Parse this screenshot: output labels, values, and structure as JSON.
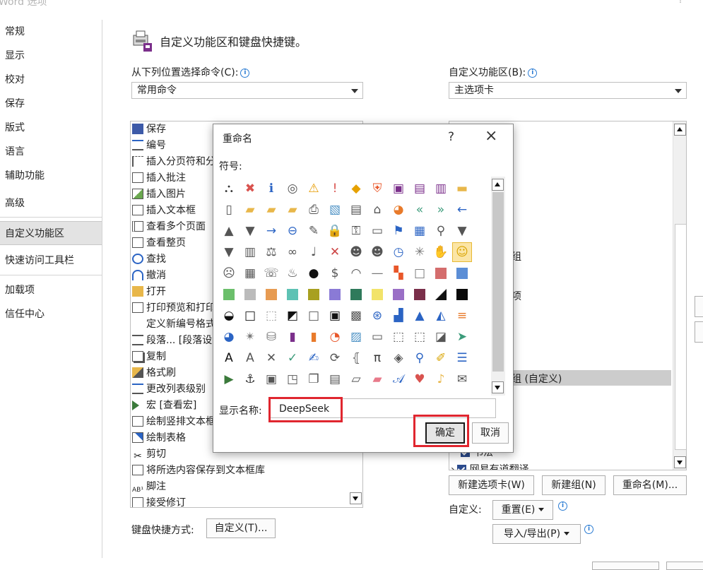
{
  "window": {
    "title": "Word 选项",
    "help": "?"
  },
  "nav": {
    "items": [
      {
        "label": "常规",
        "selected": false
      },
      {
        "label": "显示",
        "selected": false
      },
      {
        "label": "校对",
        "selected": false
      },
      {
        "label": "保存",
        "selected": false
      },
      {
        "label": "版式",
        "selected": false
      },
      {
        "label": "语言",
        "selected": false
      },
      {
        "label": "辅助功能",
        "selected": false
      },
      {
        "label": "高级",
        "selected": false
      },
      {
        "label": "自定义功能区",
        "selected": true
      },
      {
        "label": "快速访问工具栏",
        "selected": false
      },
      {
        "label": "加载项",
        "selected": false
      },
      {
        "label": "信任中心",
        "selected": false
      }
    ]
  },
  "header": {
    "title": "自定义功能区和键盘快捷键。"
  },
  "left_panel": {
    "choose_label": "从下列位置选择命令(C):",
    "choose_value": "常用命令",
    "commands": [
      {
        "label": "保存",
        "icon": "save-icon"
      },
      {
        "label": "编号",
        "icon": "numbering-icon"
      },
      {
        "label": "插入分页符和分",
        "icon": "page-break-icon"
      },
      {
        "label": "插入批注",
        "icon": "comment-icon"
      },
      {
        "label": "插入图片",
        "icon": "picture-icon"
      },
      {
        "label": "插入文本框",
        "icon": "textbox-icon"
      },
      {
        "label": "查看多个页面",
        "icon": "multi-page-icon"
      },
      {
        "label": "查看整页",
        "icon": "full-page-icon"
      },
      {
        "label": "查找",
        "icon": "find-icon"
      },
      {
        "label": "撤消",
        "icon": "undo-icon"
      },
      {
        "label": "打开",
        "icon": "open-icon"
      },
      {
        "label": "打印预览和打印",
        "icon": "print-preview-icon"
      },
      {
        "label": "定义新编号格式",
        "icon": ""
      },
      {
        "label": "段落... [段落设",
        "icon": "paragraph-icon"
      },
      {
        "label": "复制",
        "icon": "copy-icon"
      },
      {
        "label": "格式刷",
        "icon": "format-painter-icon"
      },
      {
        "label": "更改列表级别",
        "icon": "list-level-icon"
      },
      {
        "label": "宏 [查看宏]",
        "icon": "macro-icon"
      },
      {
        "label": "绘制竖排文本框",
        "icon": "vertical-textbox-icon"
      },
      {
        "label": "绘制表格",
        "icon": "draw-table-icon"
      },
      {
        "label": "剪切",
        "icon": "cut-icon"
      },
      {
        "label": "将所选内容保存到文本框库",
        "icon": "save-selection-icon"
      },
      {
        "label": "脚注",
        "icon": "footnote-icon"
      },
      {
        "label": "接受修订",
        "icon": "accept-icon"
      }
    ],
    "keyboard_label": "键盘快捷方式:",
    "keyboard_button": "自定义(T)..."
  },
  "right_panel": {
    "customize_label": "自定义功能区(B):",
    "customize_value": "主选项卡",
    "visible_fragments": {
      "a": "组",
      "b": "项",
      "c": "组 (自定义)",
      "d": "书法",
      "e": "网易有道翻译"
    },
    "new_tab": "新建选项卡(W)",
    "new_group": "新建组(N)",
    "rename": "重命名(M)...",
    "customizations_label": "自定义:",
    "reset": "重置(E)",
    "import_export": "导入/导出(P)"
  },
  "dialog": {
    "title": "重命名",
    "help": "?",
    "close": "×",
    "symbol_label": "符号:",
    "display_name_label": "显示名称:",
    "display_name_value": "DeepSeek",
    "ok": "确定",
    "cancel": "取消",
    "selected_symbol": "smiley-icon",
    "highlight_color": "#e0262f"
  },
  "symbols": [
    [
      "network-icon",
      "error-icon",
      "info-icon",
      "target-icon",
      "warning-icon",
      "exclamation-icon",
      "diamond-warning-icon",
      "shield-icon",
      "save-icon",
      "save-all-icon",
      "save-as-icon",
      "folder-icon"
    ],
    [
      "page-icon",
      "folder-open-icon",
      "folder-upload-icon",
      "folder-share-icon",
      "printer-icon",
      "picture-icon",
      "document-icon",
      "home-icon",
      "pie-chart-icon",
      "double-left-icon",
      "double-right-icon",
      "left-arrow-icon"
    ],
    [
      "triangle-up-icon",
      "triangle-down-icon",
      "right-arrow-icon",
      "circle-left-icon",
      "pin-icon",
      "lock-icon",
      "key-icon",
      "edit-page-icon",
      "flag-icon",
      "window-icon",
      "search-icon",
      "filter-icon"
    ],
    [
      "filter2-icon",
      "book-icon",
      "scales-icon",
      "rings-icon",
      "microphone-icon",
      "mute-icon",
      "person-icon",
      "person2-icon",
      "clock-icon",
      "sparkle-icon",
      "hand-icon",
      "smiley-icon"
    ],
    [
      "sad-icon",
      "calculator-icon",
      "phone-icon",
      "piggy-icon",
      "ball-icon",
      "dollar-icon",
      "eye-icon",
      "dash-icon",
      "grid-color-icon",
      "square-outline-icon",
      "square-pink",
      "square-blue"
    ],
    [
      "square-green",
      "square-gray",
      "square-orange",
      "square-teal",
      "square-olive",
      "square-purple",
      "square-darkgreen",
      "square-yellow",
      "square-violet",
      "square-maroon",
      "square-split",
      "square-black"
    ],
    [
      "half-square-icon",
      "box-outline-icon",
      "dotted-box-icon",
      "half-fill-icon",
      "box-thin-icon",
      "bar-box-icon",
      "checker-icon",
      "circle-arrow-icon",
      "bar-chart-icon",
      "cone-icon",
      "mountain-icon",
      "bars-h-icon"
    ],
    [
      "pie2-icon",
      "radar-icon",
      "cylinder-icon",
      "book-purple-icon",
      "book-orange-icon",
      "chart-pie-icon",
      "image-wave-icon",
      "rect-outline-icon",
      "dashed-rect-icon",
      "dashed-rect2-icon",
      "diagonal-icon",
      "flow-icon"
    ],
    [
      "letter-a-icon",
      "letter-a-gray-icon",
      "cross-icon",
      "check-icon",
      "edit-check-icon",
      "refresh-icon",
      "bracket-icon",
      "pi-icon",
      "bucket-icon",
      "search2-icon",
      "brush-icon",
      "list-icon"
    ],
    [
      "play-icon",
      "anchor-icon",
      "toolbox-icon",
      "shapes-icon",
      "copy2-icon",
      "document2-icon",
      "folder2-icon",
      "eraser-icon",
      "a-cursive-icon",
      "heart-check-icon",
      "bell-icon",
      "envelope-open-icon"
    ]
  ]
}
